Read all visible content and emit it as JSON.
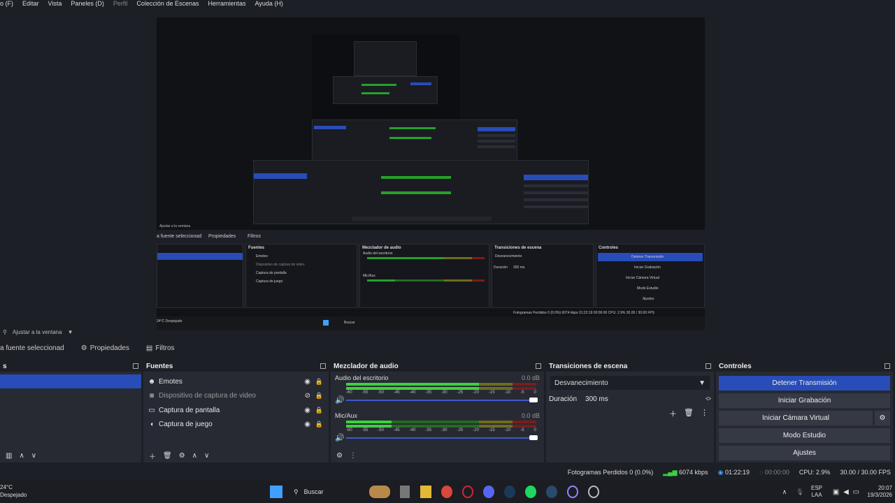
{
  "menu": [
    {
      "label": "o (F)",
      "dim": false
    },
    {
      "label": "Editar",
      "dim": false
    },
    {
      "label": "Vista",
      "dim": false
    },
    {
      "label": "Paneles (D)",
      "dim": false
    },
    {
      "label": "Perfil",
      "dim": true
    },
    {
      "label": "Colección de Escenas",
      "dim": false
    },
    {
      "label": "Herramientas",
      "dim": false
    },
    {
      "label": "Ayuda (H)",
      "dim": false
    }
  ],
  "preview": {
    "fit_label": "Ajustar a la ventana",
    "mini": {
      "sources_title": "Fuentes",
      "mixer_title": "Mezclador de audio",
      "transitions_title": "Transiciones de escena",
      "controls_title": "Controles",
      "toolbar_text": "a fuente seleccionad",
      "props": "Propiedades",
      "filters": "Filtros",
      "sources": [
        "Emotes",
        "Dispositivo de captura de video",
        "Captura de pantalla",
        "Captura de juego"
      ],
      "audio1": "Audio del escritorio",
      "audio2": "Mic/Aux",
      "transition": "Desvanecimiento",
      "duration_label": "Duración",
      "duration": "300 ms",
      "buttons": [
        "Detener Transmisión",
        "Iniciar Grabación",
        "Iniciar Cámara Virtual",
        "Modo Estudio",
        "Ajustes"
      ],
      "status": "Fotogramas Perdidos 0 (0.0%)   6074 kbps   01:22:19   00:00:00   CPU: 2.9%   30.00 / 30.00 FPS",
      "weather": "24°C Despejado",
      "search": "Buscar"
    }
  },
  "fit_row": {
    "label": "Ajustar a la ventana"
  },
  "toolbar": {
    "no_source": "a fuente seleccionad",
    "properties": "Propiedades",
    "filters": "Filtros"
  },
  "scenes_dock": {
    "title": "s"
  },
  "sources_dock": {
    "title": "Fuentes",
    "items": [
      {
        "label": "Emotes",
        "icon": "emote-icon",
        "glyph": "☻",
        "visible": true
      },
      {
        "label": "Dispositivo de captura de video",
        "icon": "camera-icon",
        "glyph": "◙",
        "visible": false
      },
      {
        "label": "Captura de pantalla",
        "icon": "monitor-icon",
        "glyph": "▭",
        "visible": true
      },
      {
        "label": "Captura de juego",
        "icon": "gamepad-icon",
        "glyph": "◖",
        "visible": true
      }
    ]
  },
  "mixer_dock": {
    "title": "Mezclador de audio",
    "channels": [
      {
        "name": "Audio del escritorio",
        "db": "0.0 dB",
        "level": 0.7
      },
      {
        "name": "Mic/Aux",
        "db": "0.0 dB",
        "level": 0.24
      }
    ],
    "ticks": [
      "-60",
      "-55",
      "-50",
      "-45",
      "-40",
      "-35",
      "-30",
      "-25",
      "-20",
      "-15",
      "-10",
      "-5",
      "0"
    ]
  },
  "transitions_dock": {
    "title": "Transiciones de escena",
    "selected": "Desvanecimiento",
    "duration_label": "Duración",
    "duration_value": "300 ms"
  },
  "controls_dock": {
    "title": "Controles",
    "stop_stream": "Detener Transmisión",
    "start_record": "Iniciar Grabación",
    "virtual_cam": "Iniciar Cámara Virtual",
    "studio_mode": "Modo Estudio",
    "settings": "Ajustes"
  },
  "status": {
    "dropped": "Fotogramas Perdidos 0 (0.0%)",
    "bitrate": "6074 kbps",
    "stream_time": "01:22:19",
    "rec_time": "00:00:00",
    "cpu": "CPU: 2.9%",
    "fps": "30.00 / 30.00 FPS"
  },
  "taskbar": {
    "temp": "24°C",
    "weather": "Despejado",
    "search": "Buscar",
    "lang": "ESP",
    "region": "LAA",
    "time": "20:07",
    "date": "19/3/2026"
  },
  "colors": {
    "accent": "#284cb8",
    "meter_green": "#3bd33b",
    "panel": "#272a33",
    "background": "#1d1f26"
  }
}
